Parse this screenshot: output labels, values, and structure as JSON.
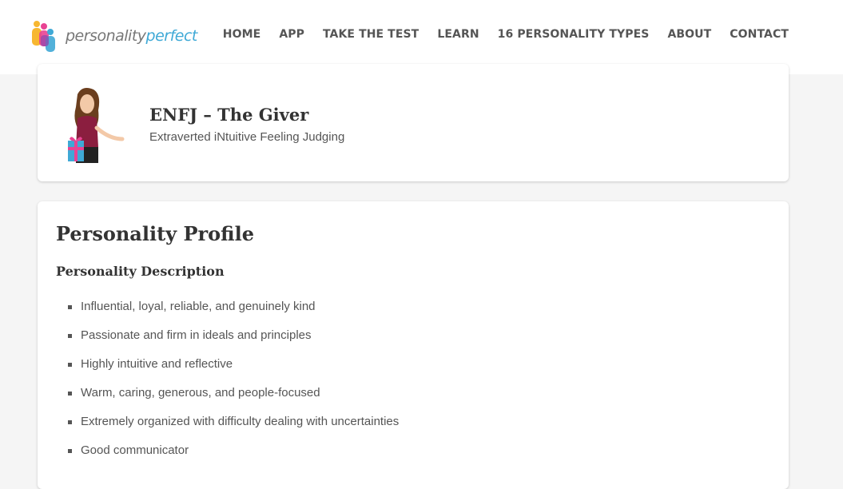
{
  "header": {
    "logo": {
      "text_a": "personality",
      "text_b": "perfect"
    },
    "nav": [
      "HOME",
      "APP",
      "TAKE THE TEST",
      "LEARN",
      "16 PERSONALITY TYPES",
      "ABOUT",
      "CONTACT"
    ]
  },
  "type_card": {
    "title": "ENFJ – The Giver",
    "subtitle": "Extraverted iNtuitive Feeling Judging"
  },
  "profile": {
    "heading": "Personality Profile",
    "section_heading": "Personality Description",
    "items": [
      "Influential, loyal, reliable, and genuinely kind",
      "Passionate and firm in ideals and principles",
      "Highly intuitive and reflective",
      "Warm, caring, generous, and people-focused",
      "Extremely organized with difficulty dealing with uncertainties",
      "Good communicator"
    ]
  },
  "colors": {
    "accent": "#3fa9d6",
    "text": "#333333",
    "muted": "#555555"
  }
}
